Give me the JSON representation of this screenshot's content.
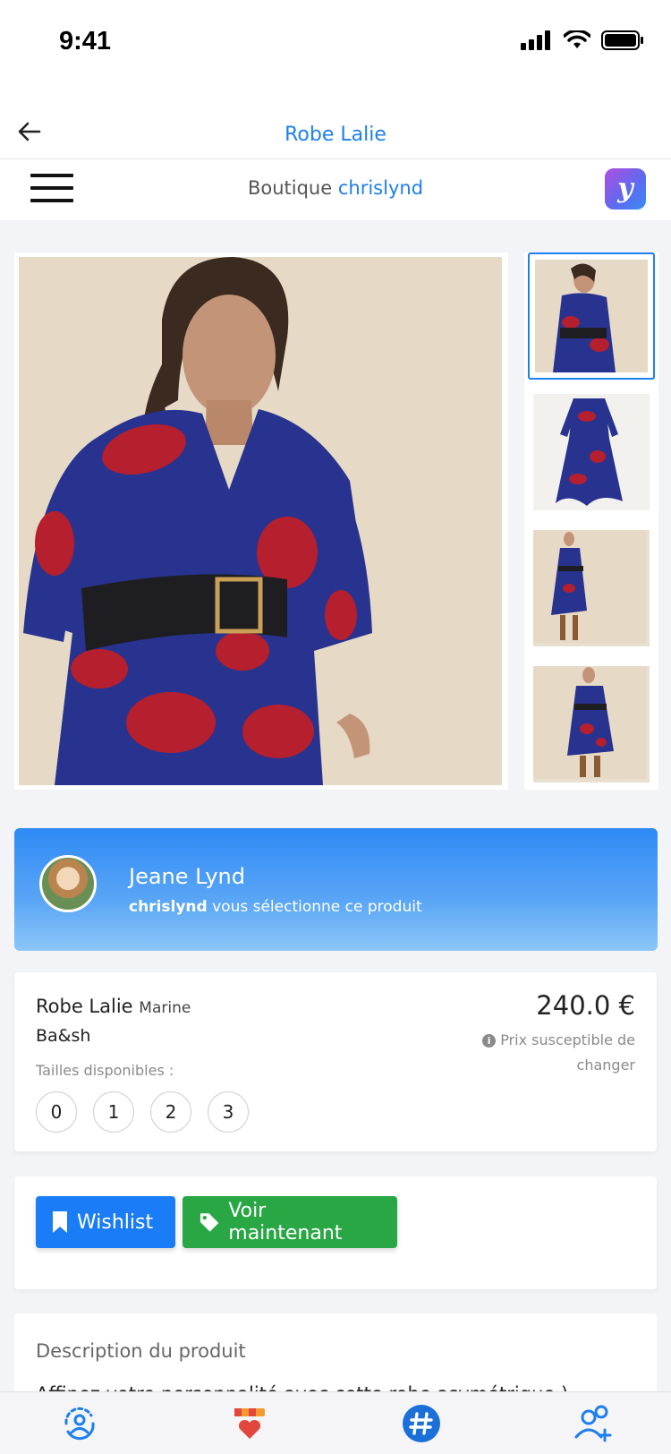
{
  "status_bar": {
    "time": "9:41"
  },
  "title_bar": {
    "title": "Robe Lalie"
  },
  "shop_bar": {
    "prefix": "Boutique",
    "shop_name": "chrislynd",
    "logo_letter": "y"
  },
  "curator": {
    "name": "Jeane Lynd",
    "handle": "chrislynd",
    "message": " vous sélectionne ce produit"
  },
  "product": {
    "name": "Robe Lalie",
    "color": "Marine",
    "brand": "Ba&sh",
    "price": "240.0 €",
    "price_note": "Prix susceptible de changer",
    "sizes_label": "Tailles disponibles :",
    "sizes": [
      "0",
      "1",
      "2",
      "3"
    ]
  },
  "actions": {
    "wishlist_label": "Wishlist",
    "voir_label": "Voir maintenant"
  },
  "description": {
    "title": "Description du produit",
    "text": "Affinez votre personnalité avec cette robe asymétrique )"
  },
  "colors": {
    "accent": "#1d7ff0",
    "wishlist": "#1a7cf6",
    "voir": "#29a744",
    "dress_blue": "#27338f",
    "dress_red": "#b51f2e"
  },
  "icons": {
    "tab_1": "user-refresh-icon",
    "tab_2": "shop-heart-icon",
    "tab_3": "hashtag-icon",
    "tab_4": "add-user-icon"
  }
}
